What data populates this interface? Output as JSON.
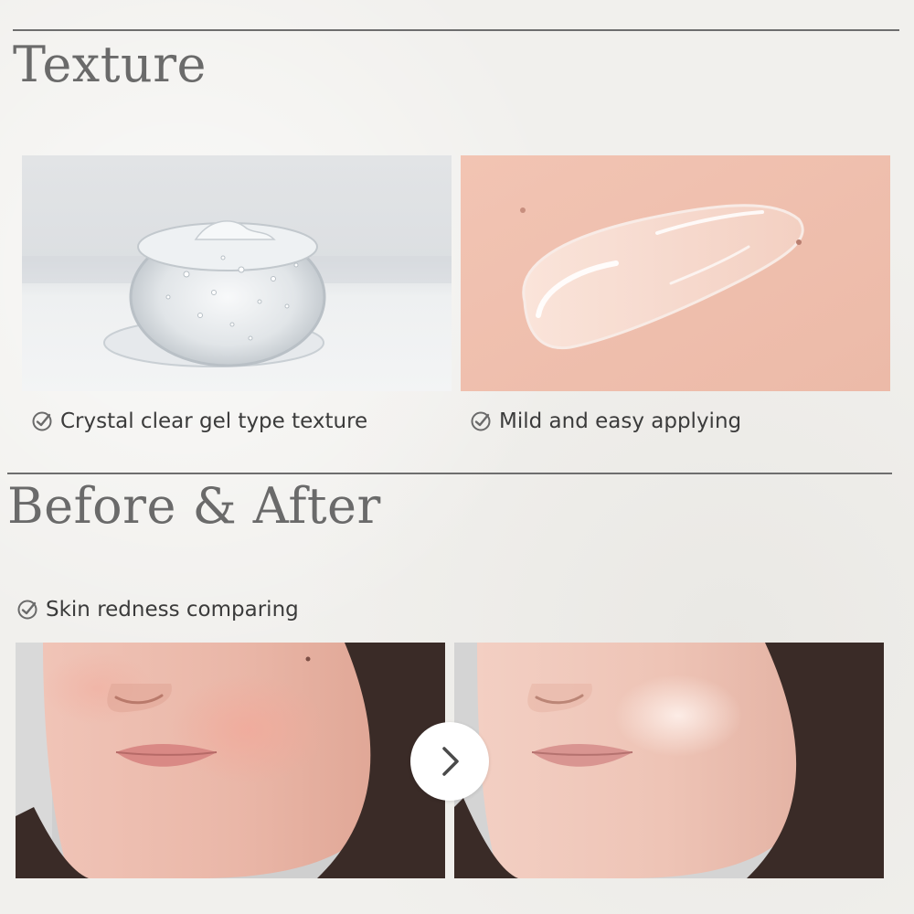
{
  "texture": {
    "heading": "Texture",
    "items": [
      {
        "caption": "Crystal clear gel type texture",
        "icon": "check-circle-icon"
      },
      {
        "caption": "Mild and easy applying",
        "icon": "check-circle-icon"
      }
    ]
  },
  "before_after": {
    "heading": "Before & After",
    "caption": "Skin redness comparing",
    "icon": "check-circle-icon",
    "next_icon": "chevron-right-icon"
  },
  "colors": {
    "background": "#f1f0ed",
    "heading": "#6a6a6a",
    "caption": "#3b3b3b",
    "rule": "#6e6e6e"
  }
}
